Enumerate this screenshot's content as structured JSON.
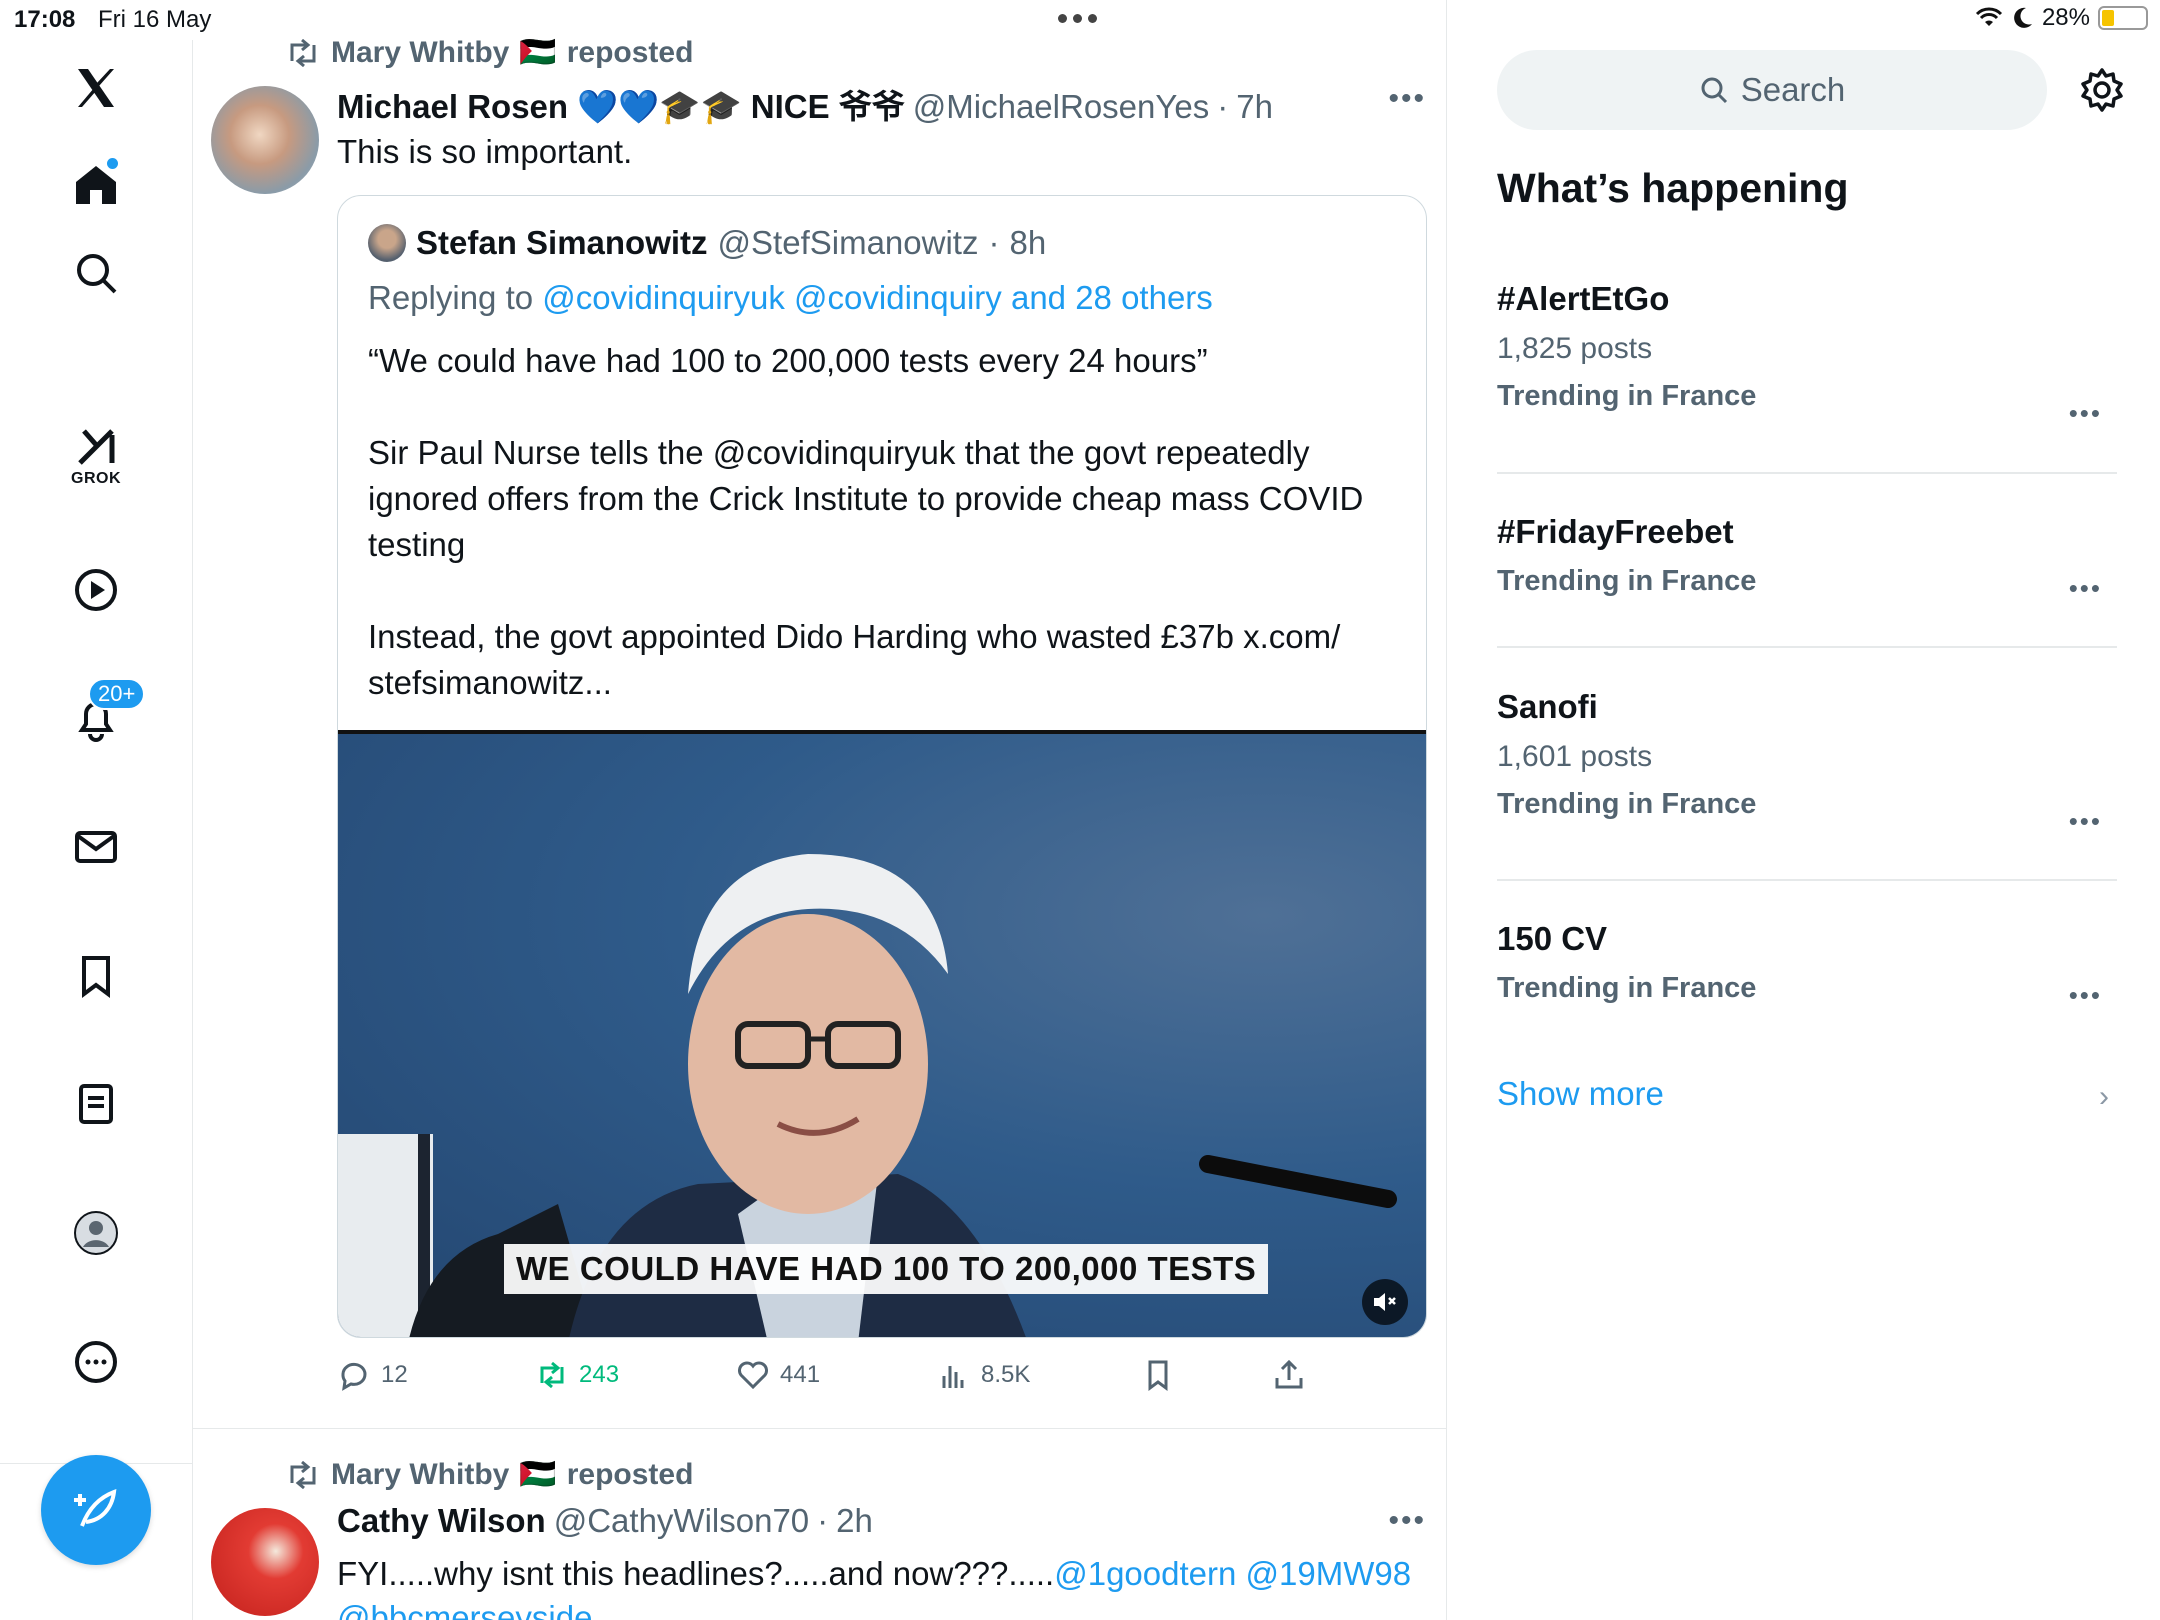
{
  "status_bar": {
    "time": "17:08",
    "date": "Fri 16 May",
    "battery": "28%",
    "battery_level": 0.28
  },
  "sidebar": {
    "items": [
      {
        "icon": "x-logo-icon"
      },
      {
        "icon": "home-icon"
      },
      {
        "icon": "search-icon"
      },
      {
        "icon": "grok-icon",
        "label": "GROK"
      },
      {
        "icon": "video-play-icon"
      },
      {
        "icon": "bell-icon",
        "badge": "20+"
      },
      {
        "icon": "mail-icon"
      },
      {
        "icon": "bookmark-icon"
      },
      {
        "icon": "list-icon"
      },
      {
        "icon": "profile-icon"
      },
      {
        "icon": "more-circle-icon"
      }
    ],
    "compose_icon": "compose-feather-icon"
  },
  "feed": {
    "tweets": [
      {
        "reposted_by": "Mary Whitby",
        "reposted_label": "reposted",
        "flag": "🇵🇸",
        "name": "Michael Rosen 💙💙🎓🎓 NICE 爷爷",
        "handle": "@MichaelRosenYes",
        "time": "7h",
        "text": "This is so important.",
        "quote": {
          "name": "Stefan Simanowitz",
          "handle": "@StefSimanowitz",
          "time": "8h",
          "replying_label": "Replying to",
          "replying_to": "@covidinquiryuk @covidinquiry and 28 others",
          "paragraphs": [
            "“We could have had 100 to 200,000 tests every 24 hours”",
            "Sir Paul Nurse tells the @covidinquiryuk that the govt repeatedly ignored offers from the Crick Institute to provide cheap mass COVID testing",
            "Instead, the govt appointed Dido Harding who wasted £37b x.com/ stefsimanowitz..."
          ],
          "video_caption": "WE COULD HAVE HAD 100 TO 200,000 TESTS"
        },
        "actions": {
          "replies": "12",
          "reposts": "243",
          "likes": "441",
          "views": "8.5K"
        }
      },
      {
        "reposted_by": "Mary Whitby",
        "reposted_label": "reposted",
        "flag": "🇵🇸",
        "name": "Cathy Wilson",
        "handle": "@CathyWilson70",
        "time": "2h",
        "text_plain": "FYI.....why isnt this headlines?.....and now???.....",
        "text_links": "@1goodtern @19MW98",
        "text_line2": "@bbcmerseyside"
      }
    ]
  },
  "right": {
    "search_placeholder": "Search",
    "section_title": "What’s happening",
    "trends": [
      {
        "name": "#AlertEtGo",
        "posts": "1,825 posts",
        "context": "Trending in France"
      },
      {
        "name": "#FridayFreebet",
        "posts": "",
        "context": "Trending in France"
      },
      {
        "name": "Sanofi",
        "posts": "1,601 posts",
        "context": "Trending in France"
      },
      {
        "name": "150 CV",
        "posts": "",
        "context": "Trending in France"
      }
    ],
    "show_more": "Show more"
  },
  "colors": {
    "accent": "#1d9bf0",
    "repost_green": "#00ba7c",
    "muted_text": "#536471"
  }
}
